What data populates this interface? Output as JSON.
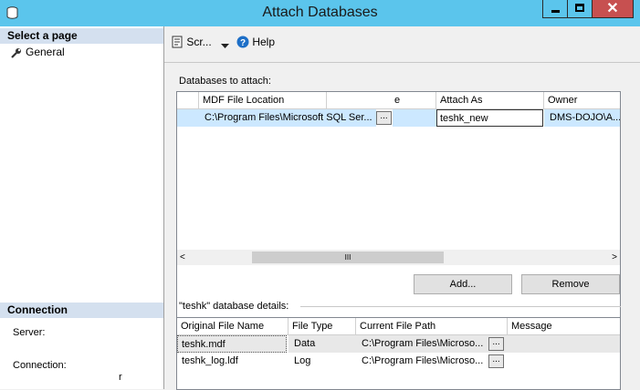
{
  "window": {
    "title": "Attach Databases",
    "close_glyph": "✕"
  },
  "left_panel": {
    "select_page_header": "Select a page",
    "pages": [
      {
        "label": "General",
        "icon": "wrench-icon"
      }
    ],
    "connection_header": "Connection",
    "server_label": "Server:",
    "connection_label": "Connection:",
    "connection_value": "r"
  },
  "toolbar": {
    "script_label": "Scr...",
    "help_label": "Help"
  },
  "attach": {
    "section_label": "Databases to attach:",
    "columns": [
      "MDF File Location",
      "e",
      "Attach As",
      "Owner"
    ],
    "row": {
      "mdf_location": "C:\\Program Files\\Microsoft SQL Ser...",
      "attach_as": "teshk_new",
      "owner": "DMS-DOJO\\A..."
    },
    "scroll_thumb": "III",
    "add_button": "Add...",
    "remove_button": "Remove"
  },
  "details": {
    "section_label": "\"teshk\" database details:",
    "columns": [
      "Original File Name",
      "File Type",
      "Current File Path",
      "Message"
    ],
    "rows": [
      {
        "name": "teshk.mdf",
        "type": "Data",
        "path": "C:\\Program Files\\Microso...",
        "message": ""
      },
      {
        "name": "teshk_log.ldf",
        "type": "Log",
        "path": "C:\\Program Files\\Microso...",
        "message": ""
      }
    ]
  },
  "colors": {
    "titlebar": "#5bc5ec",
    "selection": "#cce8ff",
    "section_header": "#d4e0ef"
  }
}
